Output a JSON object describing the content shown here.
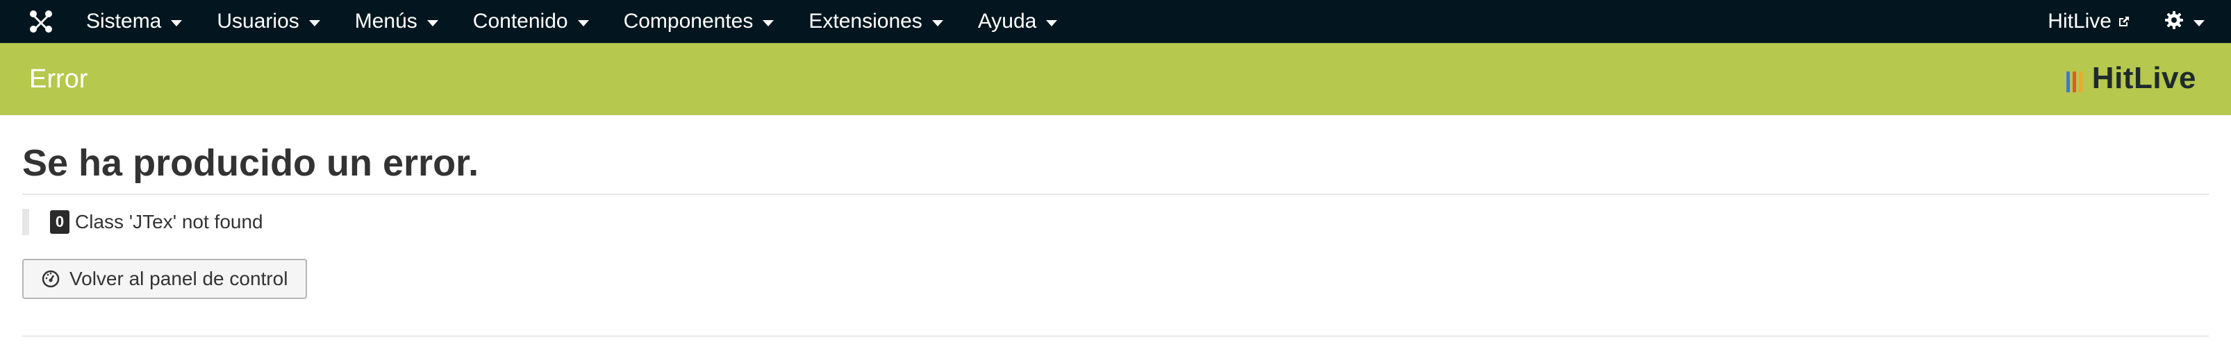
{
  "navbar": {
    "logo_icon": "joomla-logo-icon",
    "menu": [
      {
        "label": "Sistema"
      },
      {
        "label": "Usuarios"
      },
      {
        "label": "Menús"
      },
      {
        "label": "Contenido"
      },
      {
        "label": "Componentes"
      },
      {
        "label": "Extensiones"
      },
      {
        "label": "Ayuda"
      }
    ],
    "site_link": {
      "label": "HitLive",
      "icon": "external-link-icon"
    },
    "settings_icon": "gear-icon"
  },
  "header": {
    "title": "Error",
    "brand": "HitLive",
    "brand_bar_colors": [
      "#3a7bd5",
      "#e8542c",
      "#f2a72b"
    ]
  },
  "main": {
    "error_heading": "Se ha producido un error.",
    "error_code": "0",
    "error_message": "Class 'JTex' not found",
    "back_button": {
      "label": "Volver al panel de control",
      "icon": "dashboard-icon"
    }
  },
  "colors": {
    "navbar_bg": "#03161f",
    "header_bg": "#b6c84d"
  }
}
